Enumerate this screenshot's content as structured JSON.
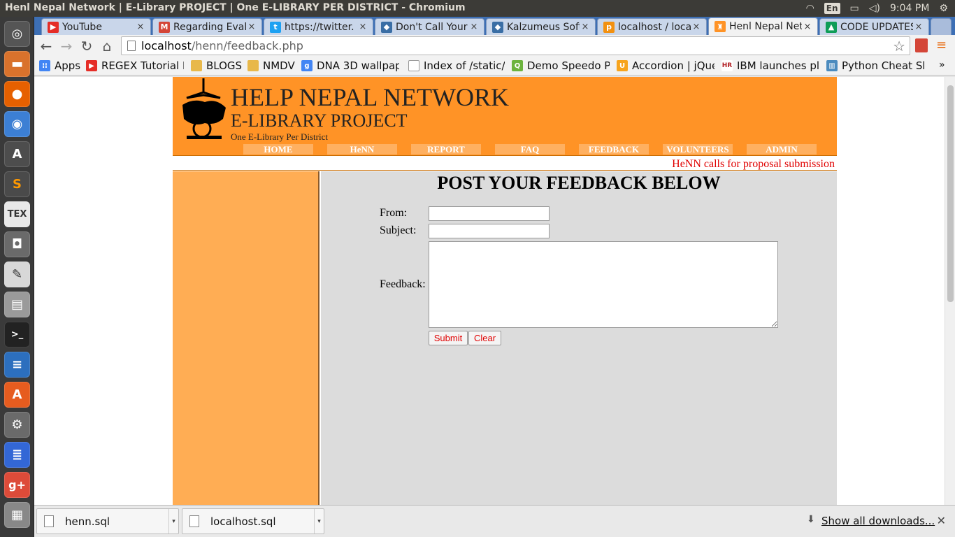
{
  "window": {
    "title": "Henl Nepal Network | E-Library PROJECT | One E-LIBRARY PER DISTRICT - Chromium"
  },
  "tray": {
    "lang": "En",
    "time": "9:04 PM"
  },
  "tabs": [
    {
      "label": "YouTube",
      "icon": "youtube-icon",
      "color": "#e52d27"
    },
    {
      "label": "Regarding Eval",
      "icon": "gmail-icon",
      "color": "#d44638"
    },
    {
      "label": "https://twitter.",
      "icon": "twitter-icon",
      "color": "#1da1f2"
    },
    {
      "label": "Don't Call Your",
      "icon": "dragon-icon",
      "color": "#3a6ea5"
    },
    {
      "label": "Kalzumeus Soft",
      "icon": "dragon-icon",
      "color": "#3a6ea5"
    },
    {
      "label": "localhost / loca",
      "icon": "phpmyadmin-icon",
      "color": "#f29111"
    },
    {
      "label": "Henl Nepal Net",
      "icon": "henn-icon",
      "color": "#ff9326"
    },
    {
      "label": "CODE UPDATES",
      "icon": "drive-icon",
      "color": "#0f9d58"
    }
  ],
  "address": {
    "host": "localhost",
    "path": "/henn/feedback.php"
  },
  "bookmarks": [
    {
      "label": "Apps",
      "icon": "apps-icon",
      "color": "#4285f4"
    },
    {
      "label": "REGEX Tutorial R",
      "icon": "youtube-icon",
      "color": "#e52d27"
    },
    {
      "label": "BLOGS",
      "icon": "folder-icon",
      "color": "#e8b84a"
    },
    {
      "label": "NMDV",
      "icon": "folder-icon",
      "color": "#e8b84a"
    },
    {
      "label": "DNA 3D wallpape",
      "icon": "google-icon",
      "color": "#4285f4"
    },
    {
      "label": "Index of /static/g",
      "icon": "page-icon",
      "color": "#999999"
    },
    {
      "label": "Demo Speedo Po",
      "icon": "speedo-icon",
      "color": "#6cb33e"
    },
    {
      "label": "Accordion | jQuer",
      "icon": "jquery-ui-icon",
      "color": "#f7a41d"
    },
    {
      "label": "IBM launches pla",
      "icon": "hr-icon",
      "color": "#b11f24"
    },
    {
      "label": "Python Cheat She",
      "icon": "python-icon",
      "color": "#4b8bbe"
    }
  ],
  "site": {
    "title": "HELP NEPAL NETWORK",
    "subtitle": "E-LIBRARY PROJECT",
    "tagline": "One E-Library Per District",
    "menu": [
      "HOME",
      "HeNN",
      "REPORT",
      "FAQ",
      "FEEDBACK",
      "VOLUNTEERS",
      "ADMIN"
    ],
    "notice": "HeNN calls for proposal submission",
    "heading": "POST YOUR FEEDBACK BELOW",
    "form": {
      "from_label": "From:",
      "subject_label": "Subject:",
      "feedback_label": "Feedback:",
      "submit": "Submit",
      "clear": "Clear"
    }
  },
  "downloads": {
    "items": [
      "henn.sql",
      "localhost.sql"
    ],
    "show_all": "Show all downloads..."
  }
}
